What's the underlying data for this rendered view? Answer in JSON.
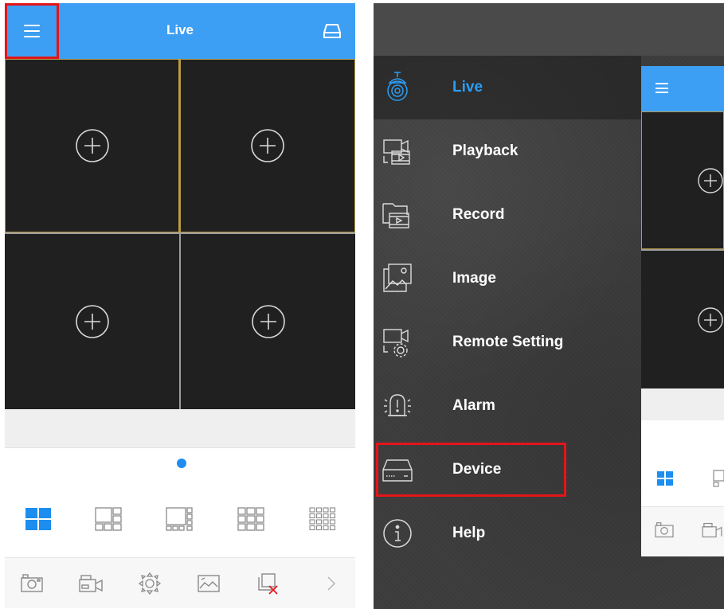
{
  "left_screen": {
    "title": "Live",
    "icons": {
      "menu": "hamburger-menu-icon",
      "device": "dvr-device-icon",
      "add": "add-channel-icon"
    },
    "grid": {
      "cells": [
        {
          "id": 1,
          "selected": true
        },
        {
          "id": 2,
          "selected": false
        },
        {
          "id": 3,
          "selected": false
        },
        {
          "id": 4,
          "selected": false
        }
      ]
    },
    "page_indicator": {
      "count": 1,
      "active": 1
    },
    "layouts": [
      {
        "name": "1x4",
        "icon": "layout-4-split-icon",
        "active": true
      },
      {
        "name": "1+5",
        "icon": "layout-6-split-icon",
        "active": false
      },
      {
        "name": "1+7",
        "icon": "layout-8-split-icon",
        "active": false
      },
      {
        "name": "3x3",
        "icon": "layout-9-split-icon",
        "active": false
      },
      {
        "name": "4x4",
        "icon": "layout-16-split-icon",
        "active": false
      }
    ],
    "toolbar": [
      {
        "icon": "snapshot-camera-icon"
      },
      {
        "icon": "record-video-icon"
      },
      {
        "icon": "ptz-control-icon"
      },
      {
        "icon": "image-icon"
      },
      {
        "icon": "close-channel-icon"
      },
      {
        "icon": "chevron-right-icon"
      }
    ]
  },
  "drawer": {
    "items": [
      {
        "label": "Live",
        "icon": "live-camera-icon",
        "active": true
      },
      {
        "label": "Playback",
        "icon": "playback-icon",
        "active": false
      },
      {
        "label": "Record",
        "icon": "record-folder-icon",
        "active": false
      },
      {
        "label": "Image",
        "icon": "image-gallery-icon",
        "active": false
      },
      {
        "label": "Remote Setting",
        "icon": "remote-setting-icon",
        "active": false
      },
      {
        "label": "Alarm",
        "icon": "alarm-icon",
        "active": false
      },
      {
        "label": "Device",
        "icon": "device-icon",
        "active": false,
        "highlighted": true
      },
      {
        "label": "Help",
        "icon": "help-info-icon",
        "active": false
      }
    ]
  },
  "colors": {
    "accent": "#3d9ff3",
    "highlight_border": "#e3151a",
    "cell_bg": "#202020",
    "drawer_bg": "#3c3c3c"
  }
}
